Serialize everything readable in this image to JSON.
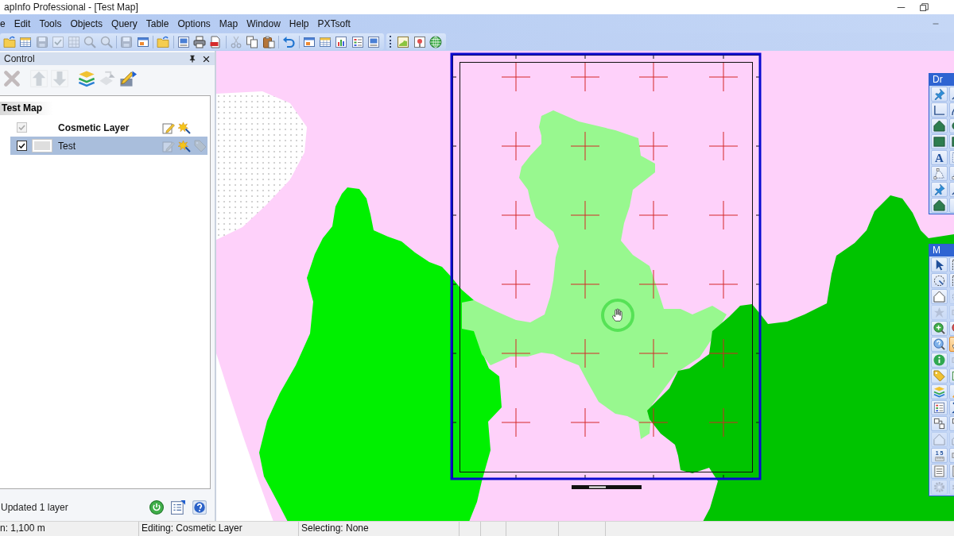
{
  "window": {
    "title": "apInfo Professional - [Test Map]"
  },
  "menu": [
    "e",
    "Edit",
    "Tools",
    "Objects",
    "Query",
    "Table",
    "Options",
    "Map",
    "Window",
    "Help",
    "PXTsoft"
  ],
  "toolbars": [
    {
      "groups": [
        [
          {
            "kind": "folder",
            "disabled": false
          },
          {
            "kind": "table",
            "disabled": false
          },
          {
            "kind": "disk",
            "disabled": true
          },
          {
            "kind": "check",
            "disabled": true
          },
          {
            "kind": "grid",
            "disabled": true
          },
          {
            "kind": "magnifier",
            "disabled": true
          },
          {
            "kind": "magnifier",
            "disabled": true
          }
        ],
        [
          {
            "kind": "disk",
            "disabled": true
          },
          {
            "kind": "window",
            "disabled": false
          }
        ],
        [
          {
            "kind": "folder",
            "disabled": false
          }
        ],
        [
          {
            "kind": "layout",
            "disabled": false
          },
          {
            "kind": "printer",
            "disabled": false
          },
          {
            "kind": "document",
            "disabled": false
          }
        ],
        [
          {
            "kind": "scissors",
            "disabled": true
          },
          {
            "kind": "copy",
            "disabled": false
          },
          {
            "kind": "clipboard",
            "disabled": false
          }
        ],
        [
          {
            "kind": "undo",
            "disabled": false
          }
        ],
        [
          {
            "kind": "window",
            "disabled": false
          },
          {
            "kind": "table",
            "disabled": false
          },
          {
            "kind": "chart",
            "disabled": false
          },
          {
            "kind": "legend",
            "disabled": false
          },
          {
            "kind": "layout",
            "disabled": false
          }
        ]
      ]
    },
    {
      "groups": [
        [
          {
            "kind": "map",
            "disabled": false
          },
          {
            "kind": "pin",
            "disabled": false
          },
          {
            "kind": "globe",
            "disabled": false
          }
        ]
      ]
    }
  ],
  "layer_control": {
    "title": "Control",
    "tools": [
      [
        {
          "kind": "remove",
          "disabled": true
        }
      ],
      [
        {
          "kind": "up",
          "disabled": true
        },
        {
          "kind": "down",
          "disabled": true
        }
      ],
      [
        {
          "kind": "layers",
          "disabled": false
        },
        {
          "kind": "reorder",
          "disabled": true
        },
        {
          "kind": "layeredit",
          "disabled": false
        }
      ]
    ],
    "map_name": "Test Map",
    "layers": [
      {
        "kind": "cosmetic",
        "name": "Cosmetic Layer",
        "checked": true,
        "disabled": true,
        "selected": false,
        "editable": true
      },
      {
        "kind": "table",
        "name": "Test",
        "checked": true,
        "disabled": false,
        "selected": true,
        "editable": false,
        "labels": false
      }
    ],
    "message": "Updated 1 layer"
  },
  "floating_toolbars": [
    {
      "title": "Dr",
      "tools": [
        {
          "kind": "pushpin",
          "selected": false,
          "disabled": false
        },
        {
          "kind": "line",
          "selected": false,
          "disabled": false
        },
        {
          "kind": "polyline",
          "selected": false,
          "disabled": false
        },
        {
          "kind": "arc",
          "selected": false,
          "disabled": false
        },
        {
          "kind": "polygon",
          "selected": false,
          "disabled": false
        },
        {
          "kind": "ellipse",
          "selected": false,
          "disabled": false
        },
        {
          "kind": "rectangle",
          "selected": false,
          "disabled": false
        },
        {
          "kind": "rectangle",
          "selected": false,
          "disabled": false
        },
        {
          "kind": "text",
          "glyph": "A",
          "selected": false,
          "disabled": false
        },
        {
          "kind": "frame",
          "selected": false,
          "disabled": false
        },
        {
          "kind": "reshape",
          "selected": false,
          "disabled": false
        },
        {
          "kind": "reshape",
          "selected": false,
          "disabled": false
        },
        {
          "kind": "pushpin",
          "selected": false,
          "disabled": false
        },
        {
          "kind": "line",
          "selected": false,
          "disabled": false
        },
        {
          "kind": "polygon",
          "selected": false,
          "disabled": false
        },
        {
          "kind": "text",
          "selected": false,
          "disabled": false
        }
      ]
    },
    {
      "title": "M",
      "tools": [
        {
          "kind": "pointer",
          "selected": false,
          "disabled": false
        },
        {
          "kind": "marquee",
          "selected": false,
          "disabled": false
        },
        {
          "kind": "radius",
          "selected": false,
          "disabled": false
        },
        {
          "kind": "marquee",
          "selected": false,
          "disabled": false
        },
        {
          "kind": "house",
          "selected": false,
          "disabled": false
        },
        {
          "kind": "radius",
          "selected": false,
          "disabled": true
        },
        {
          "kind": "star",
          "selected": false,
          "disabled": true
        },
        {
          "kind": "ruler",
          "selected": false,
          "disabled": true
        },
        {
          "kind": "zoomin",
          "selected": false,
          "disabled": false
        },
        {
          "kind": "zoomout",
          "selected": false,
          "disabled": false
        },
        {
          "kind": "question",
          "selected": false,
          "disabled": false
        },
        {
          "kind": "hand",
          "selected": true,
          "disabled": false
        },
        {
          "kind": "info",
          "selected": false,
          "disabled": false
        },
        {
          "kind": "ruler",
          "selected": false,
          "disabled": true
        },
        {
          "kind": "tag",
          "selected": false,
          "disabled": false
        },
        {
          "kind": "label",
          "selected": false,
          "disabled": false
        },
        {
          "kind": "layers",
          "selected": false,
          "disabled": false
        },
        {
          "kind": "brush",
          "selected": false,
          "disabled": false
        },
        {
          "kind": "legend",
          "selected": false,
          "disabled": false
        },
        {
          "kind": "sigma",
          "selected": false,
          "disabled": false
        },
        {
          "kind": "nodes",
          "selected": false,
          "disabled": false
        },
        {
          "kind": "nodes",
          "selected": false,
          "disabled": false
        },
        {
          "kind": "house",
          "selected": false,
          "disabled": true
        },
        {
          "kind": "house",
          "selected": false,
          "disabled": true
        },
        {
          "kind": "scale",
          "glyph": "1 5",
          "selected": false,
          "disabled": false
        },
        {
          "kind": "ruler",
          "selected": false,
          "disabled": false
        },
        {
          "kind": "list",
          "selected": false,
          "disabled": false
        },
        {
          "kind": "list",
          "selected": false,
          "disabled": false
        },
        {
          "kind": "gear",
          "selected": false,
          "disabled": true
        },
        {
          "kind": "gear",
          "selected": false,
          "disabled": true
        }
      ]
    }
  ],
  "status_bar": [
    "n: 1,100 m",
    "Editing: Cosmetic Layer",
    "Selecting: None"
  ]
}
